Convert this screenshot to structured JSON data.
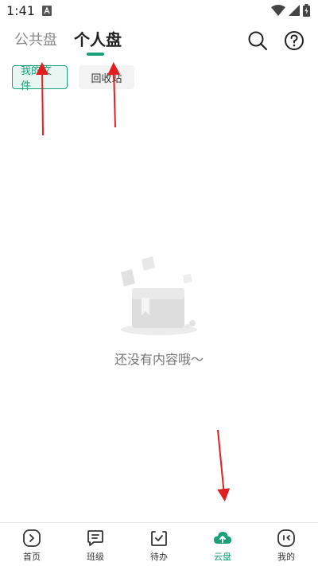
{
  "status_bar": {
    "time": "1:41"
  },
  "top_tabs": {
    "public": "公共盘",
    "personal": "个人盘"
  },
  "subtabs": {
    "my_files": "我的文件",
    "recycle_bin": "回收站"
  },
  "empty_state": {
    "message": "还没有内容哦～"
  },
  "bottom_nav": {
    "items": [
      {
        "label": "首页",
        "icon": "home-icon"
      },
      {
        "label": "班级",
        "icon": "class-icon"
      },
      {
        "label": "待办",
        "icon": "todo-icon"
      },
      {
        "label": "云盘",
        "icon": "cloud-upload-icon"
      },
      {
        "label": "我的",
        "icon": "profile-icon"
      }
    ],
    "active_index": 3
  },
  "colors": {
    "accent": "#1aa07a",
    "arrow": "#e02020"
  }
}
